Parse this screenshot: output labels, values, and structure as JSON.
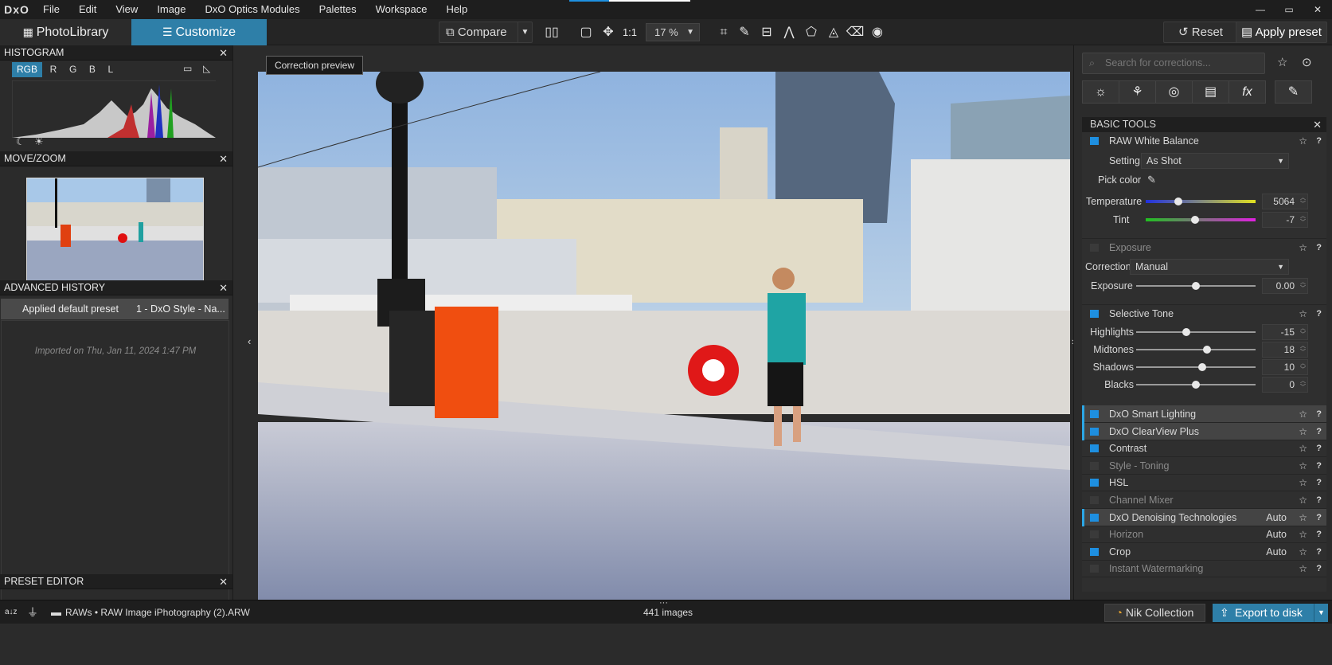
{
  "app": {
    "logo": "DxO"
  },
  "menu": [
    "File",
    "Edit",
    "View",
    "Image",
    "DxO Optics Modules",
    "Palettes",
    "Workspace",
    "Help"
  ],
  "window_controls": [
    "—",
    "▭",
    "✕"
  ],
  "tabs": {
    "photolibrary": "PhotoLibrary",
    "customize": "Customize"
  },
  "toolbar": {
    "compare": "Compare",
    "ratio": "1:1",
    "zoom": "17 %",
    "reset": "Reset",
    "apply_preset": "Apply preset"
  },
  "tooltip": "Correction preview",
  "left": {
    "histogram": {
      "title": "HISTOGRAM",
      "channels": [
        "RGB",
        "R",
        "G",
        "B",
        "L"
      ]
    },
    "movezoom": {
      "title": "MOVE/ZOOM"
    },
    "history": {
      "title": "ADVANCED HISTORY",
      "row_action": "Applied default preset",
      "row_detail": "1 - DxO Style - Na...",
      "imported": "Imported on Thu, Jan 11, 2024 1:47 PM"
    },
    "preset_editor": {
      "title": "PRESET EDITOR"
    }
  },
  "right": {
    "search_placeholder": "Search for corrections...",
    "section_title": "BASIC TOOLS",
    "white_balance": {
      "title": "RAW White Balance",
      "setting_label": "Setting",
      "setting_value": "As Shot",
      "pick_color": "Pick color",
      "temperature_label": "Temperature",
      "temperature": "5064",
      "temperature_pos": 0.3,
      "tint_label": "Tint",
      "tint": "-7",
      "tint_pos": 0.45
    },
    "exposure": {
      "title": "Exposure",
      "correction_label": "Correction",
      "correction_value": "Manual",
      "exposure_label": "Exposure",
      "exposure_value": "0.00",
      "exposure_pos": 0.5
    },
    "selective_tone": {
      "title": "Selective Tone",
      "sliders": [
        {
          "label": "Highlights",
          "value": "-15",
          "pos": 0.42
        },
        {
          "label": "Midtones",
          "value": "18",
          "pos": 0.59
        },
        {
          "label": "Shadows",
          "value": "10",
          "pos": 0.55
        },
        {
          "label": "Blacks",
          "value": "0",
          "pos": 0.5
        }
      ]
    },
    "modules": [
      {
        "label": "DxO Smart Lighting",
        "on": true,
        "highlight": true,
        "dim": false,
        "auto": ""
      },
      {
        "label": "DxO ClearView Plus",
        "on": true,
        "highlight": true,
        "dim": false,
        "auto": ""
      },
      {
        "label": "Contrast",
        "on": true,
        "highlight": false,
        "dim": false,
        "auto": ""
      },
      {
        "label": "Style - Toning",
        "on": false,
        "highlight": false,
        "dim": true,
        "auto": ""
      },
      {
        "label": "HSL",
        "on": true,
        "highlight": false,
        "dim": false,
        "auto": ""
      },
      {
        "label": "Channel Mixer",
        "on": false,
        "highlight": false,
        "dim": true,
        "auto": ""
      },
      {
        "label": "DxO Denoising Technologies",
        "on": true,
        "highlight": true,
        "dim": false,
        "auto": "Auto"
      },
      {
        "label": "Horizon",
        "on": false,
        "highlight": false,
        "dim": true,
        "auto": "Auto"
      },
      {
        "label": "Crop",
        "on": true,
        "highlight": false,
        "dim": false,
        "auto": "Auto"
      },
      {
        "label": "Instant Watermarking",
        "on": false,
        "highlight": false,
        "dim": true,
        "auto": ""
      }
    ],
    "colors": {
      "accent": "#2e7fa8",
      "check_on": "#1e8fe0"
    }
  },
  "status": {
    "sort": "a↓z",
    "path": "RAWs • RAW Image iPhotography (2).ARW",
    "count": "441 images",
    "nik": "Nik Collection",
    "export": "Export to disk"
  }
}
